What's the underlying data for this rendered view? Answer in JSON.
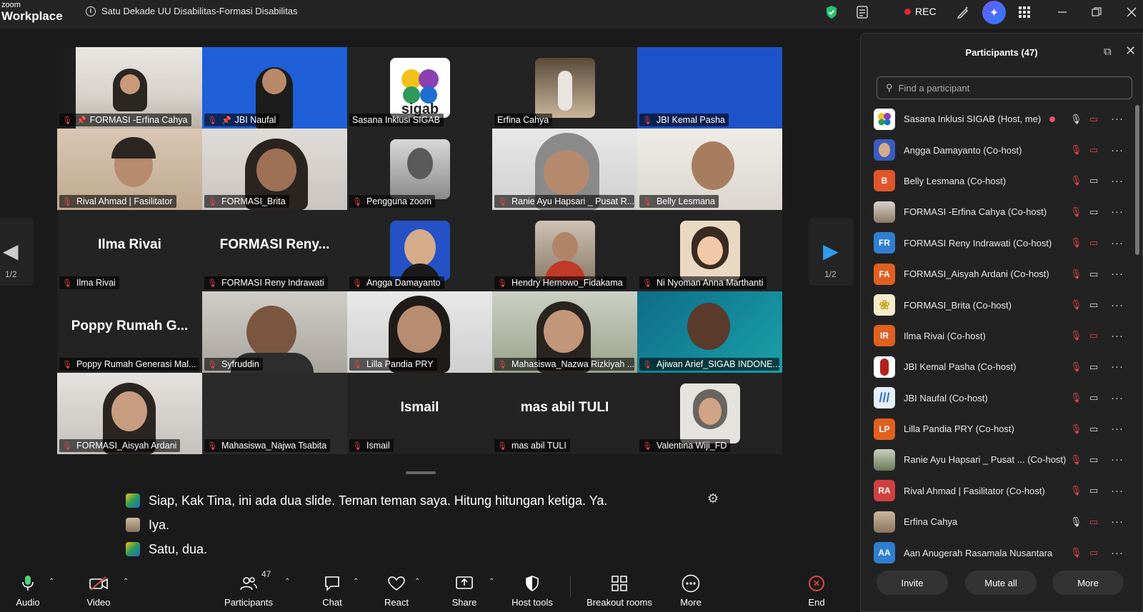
{
  "app": {
    "logo_top": "zoom",
    "logo_bottom": "Workplace",
    "meeting_title": "Satu Dekade UU Disabilitas-Formasi Disabilitas",
    "rec_label": "REC"
  },
  "grid": {
    "tiles": [
      {
        "name": "FORMASI -Erfina Cahya"
      },
      {
        "name": "JBI Naufal"
      },
      {
        "name": "Sasana Inklusi SIGAB"
      },
      {
        "name": "Erfina Cahya"
      },
      {
        "name": "JBI Kemal Pasha"
      },
      {
        "name": "Rival Ahmad | Fasilitator"
      },
      {
        "name": "FORMASI_Brita"
      },
      {
        "name": "Pengguna zoom"
      },
      {
        "name": "Ranie Ayu Hapsari _ Pusat R..."
      },
      {
        "name": "Belly Lesmana"
      },
      {
        "name": "Ilma Rivai",
        "big": "Ilma Rivai"
      },
      {
        "name": "FORMASI Reny Indrawati",
        "big": "FORMASI  Reny..."
      },
      {
        "name": "Angga Damayanto"
      },
      {
        "name": "Hendry Hernowo_Fidakama"
      },
      {
        "name": "Ni Nyoman Anna Marthanti"
      },
      {
        "name": "Poppy Rumah Generasi Mal...",
        "big": "Poppy Rumah G..."
      },
      {
        "name": "Syfruddin"
      },
      {
        "name": "Lilla Pandia PRY"
      },
      {
        "name": "Mahasiswa_Nazwa Rizkiyah ..."
      },
      {
        "name": "Ajiwan Arief_SIGAB INDONE..."
      },
      {
        "name": "FORMASI_Aisyah Ardani"
      },
      {
        "name": "Mahasiswa_Najwa Tsabita"
      },
      {
        "name": "Ismail",
        "big": "Ismail"
      },
      {
        "name": "mas abil TULI",
        "big": "mas abil TULI"
      },
      {
        "name": "Valentina Wiji_FD"
      }
    ],
    "page_left": "1/2",
    "page_right": "1/2",
    "sigab_logo": "sigab"
  },
  "captions": [
    "Siap, Kak Tina, ini ada dua slide. Teman teman saya. Hitung hitungan ketiga. Ya.",
    "Iya.",
    "Satu, dua."
  ],
  "toolbar": {
    "audio": "Audio",
    "video": "Video",
    "participants": "Participants",
    "participants_count": "47",
    "chat": "Chat",
    "react": "React",
    "share": "Share",
    "host_tools": "Host tools",
    "breakout": "Breakout rooms",
    "more": "More",
    "end": "End"
  },
  "panel": {
    "title": "Participants (47)",
    "search_placeholder": "Find a participant",
    "participants": [
      {
        "name": "Sasana Inklusi SIGAB (Host, me)",
        "initials": "",
        "color": "#ffffff"
      },
      {
        "name": "Angga Damayanto (Co-host)",
        "initials": "",
        "color": "#3a5cc0"
      },
      {
        "name": "Belly Lesmana (Co-host)",
        "initials": "B",
        "color": "#e0552a"
      },
      {
        "name": "FORMASI -Erfina Cahya (Co-host)",
        "initials": "",
        "color": "#b9a88a"
      },
      {
        "name": "FORMASI Reny Indrawati (Co-host)",
        "initials": "FR",
        "color": "#2f7fd0"
      },
      {
        "name": "FORMASI_Aisyah Ardani (Co-host)",
        "initials": "FA",
        "color": "#e06020"
      },
      {
        "name": "FORMASI_Brita (Co-host)",
        "initials": "",
        "color": "#e8d070"
      },
      {
        "name": "Ilma Rivai (Co-host)",
        "initials": "IR",
        "color": "#e06020"
      },
      {
        "name": "JBI Kemal Pasha (Co-host)",
        "initials": "",
        "color": "#ffffff"
      },
      {
        "name": "JBI Naufal (Co-host)",
        "initials": "",
        "color": "#2a6fd0"
      },
      {
        "name": "Lilla Pandia PRY (Co-host)",
        "initials": "LP",
        "color": "#e06020"
      },
      {
        "name": "Ranie Ayu Hapsari _ Pusat ...  (Co-host)",
        "initials": "",
        "color": "#8a9a70"
      },
      {
        "name": "Rival Ahmad | Fasilitator (Co-host)",
        "initials": "RA",
        "color": "#d04040"
      },
      {
        "name": "Erfina Cahya",
        "initials": "",
        "color": "#a89a80"
      },
      {
        "name": "Aan Anugerah Rasamala Nusantara",
        "initials": "AA",
        "color": "#2f7fd0"
      }
    ],
    "invite": "Invite",
    "mute_all": "Mute all",
    "more": "More"
  },
  "colors": {
    "accent": "#0e72ed",
    "active_speaker": "#25d26b",
    "muted": "#e34848",
    "rec": "#e02828"
  },
  "icons": [
    "info-icon",
    "shield-icon",
    "notes-icon",
    "rec-icon",
    "pen-icon",
    "ai-companion-icon",
    "apps-icon",
    "minimize-icon",
    "restore-icon",
    "close-icon",
    "mic-icon",
    "video-off-icon",
    "participants-icon",
    "chat-icon",
    "react-icon",
    "share-icon",
    "host-tools-icon",
    "breakout-icon",
    "more-icon",
    "end-icon",
    "gear-icon",
    "search-icon",
    "popout-icon"
  ]
}
